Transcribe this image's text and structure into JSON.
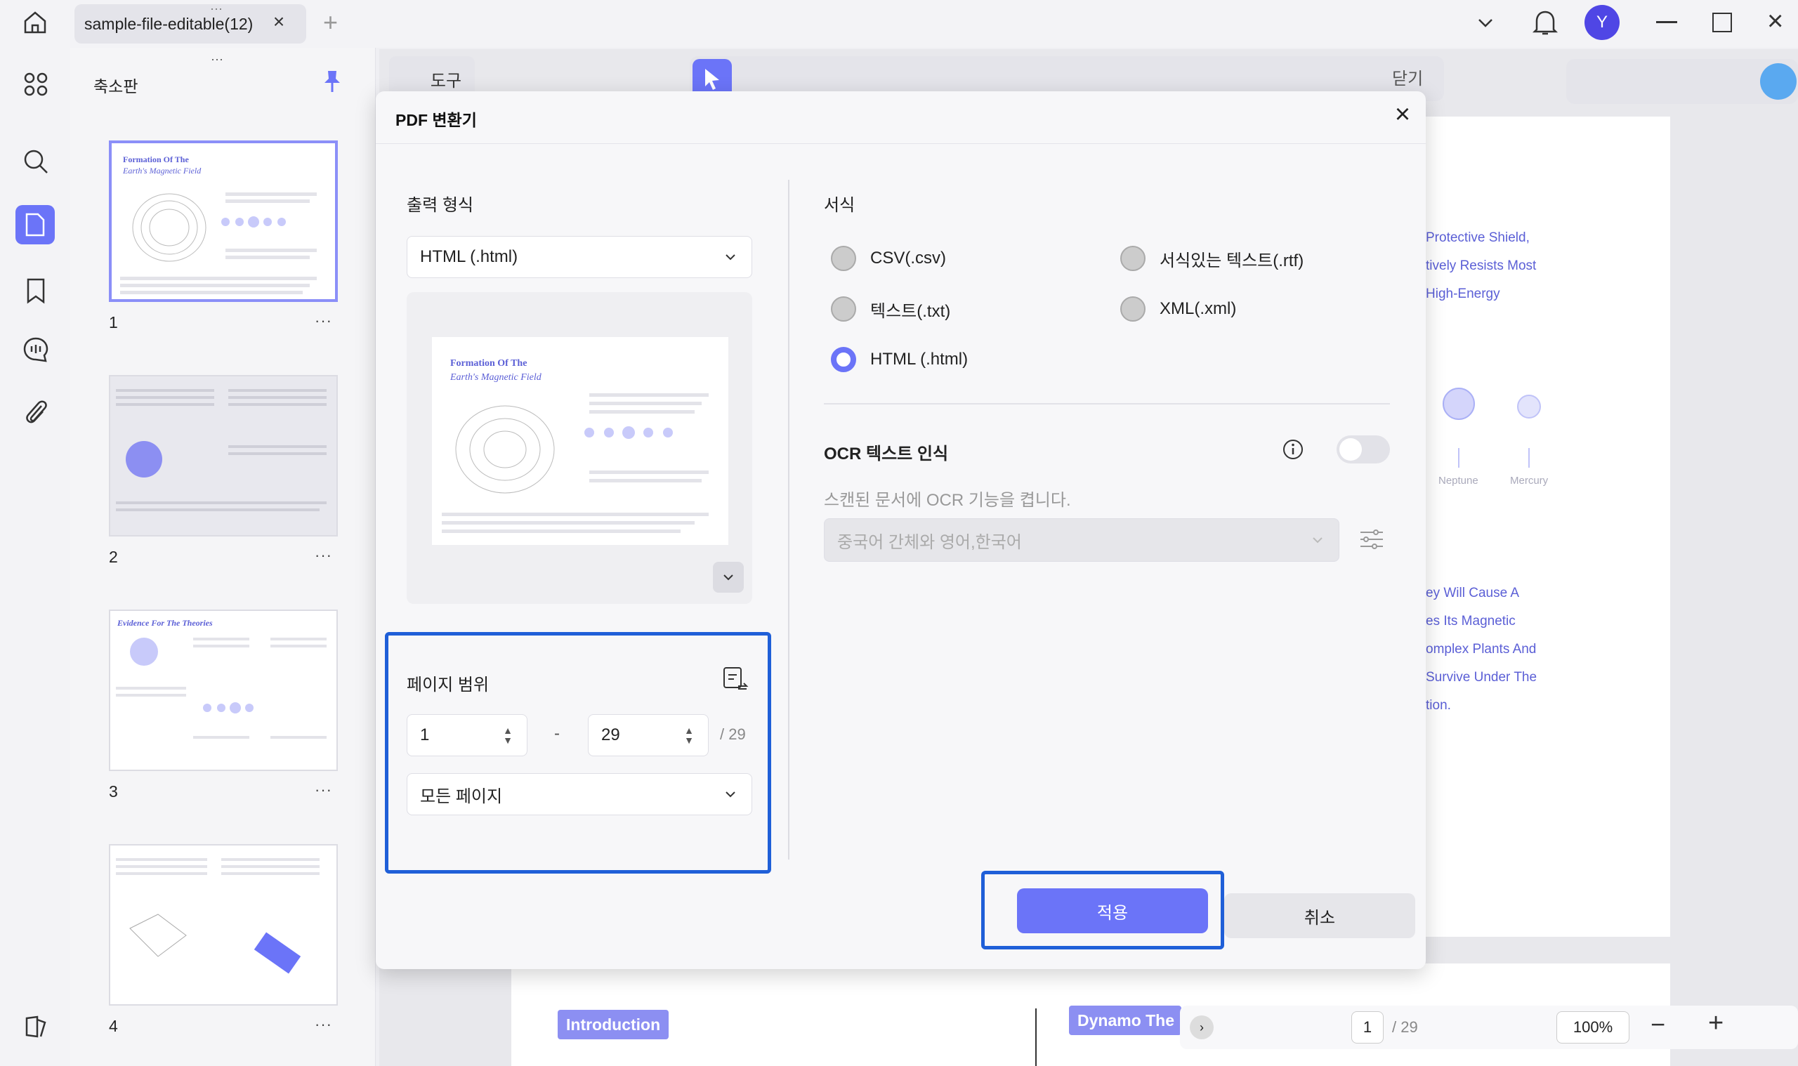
{
  "tab": {
    "title": "sample-file-editable(12)"
  },
  "user": {
    "initial": "Y"
  },
  "thumbnails": {
    "title": "축소판",
    "pages": [
      {
        "num": "1",
        "heading": "Formation Of The",
        "subheading": "Earth's Magnetic Field"
      },
      {
        "num": "2"
      },
      {
        "num": "3",
        "heading": "Evidence For The Theories"
      },
      {
        "num": "4"
      }
    ],
    "more": "···"
  },
  "toolbar": {
    "tools_label": "도구",
    "close_label": "닫기"
  },
  "document": {
    "right_text_top": [
      "Protective Shield,",
      "tively Resists Most",
      "High-Energy"
    ],
    "planet_labels": [
      "Neptune",
      "Mercury"
    ],
    "right_text_mid": [
      "ey Will Cause A",
      "es Its Magnetic",
      "omplex Plants And",
      "Survive Under The",
      "tion."
    ],
    "introduction_badge": "Introduction",
    "dynamo_badge": "Dynamo The"
  },
  "bottom_nav": {
    "page": "1",
    "total": "/ 29",
    "zoom": "100%"
  },
  "dialog": {
    "title": "PDF 변환기",
    "output_format_label": "출력 형식",
    "output_format_value": "HTML (.html)",
    "preview": {
      "heading": "Formation Of The",
      "subheading": "Earth's Magnetic Field"
    },
    "page_range": {
      "label": "페이지 범위",
      "from": "1",
      "dash": "-",
      "to": "29",
      "total": "/ 29",
      "pages_select": "모든 페이지"
    },
    "format_section_label": "서식",
    "formats": [
      {
        "label": "CSV(.csv)",
        "selected": false
      },
      {
        "label": "서식있는 텍스트(.rtf)",
        "selected": false
      },
      {
        "label": "텍스트(.txt)",
        "selected": false
      },
      {
        "label": "XML(.xml)",
        "selected": false
      },
      {
        "label": "HTML (.html)",
        "selected": true
      }
    ],
    "ocr": {
      "label": "OCR 텍스트 인식",
      "description": "스캔된 문서에 OCR 기능을 켭니다.",
      "language": "중국어 간체와 영어,한국어",
      "enabled": false
    },
    "apply_label": "적용",
    "cancel_label": "취소"
  },
  "colors": {
    "accent": "#6b74f8",
    "highlight": "#1f5fd8"
  }
}
